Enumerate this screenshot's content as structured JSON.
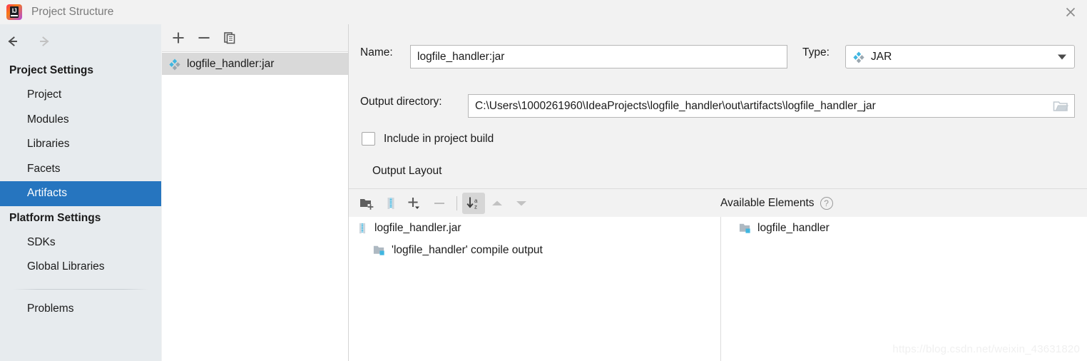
{
  "window": {
    "title": "Project Structure",
    "logo_icon": "intellij-idea-logo",
    "close_icon": "close-icon"
  },
  "nav": {
    "back_icon": "arrow-left-icon",
    "forward_icon": "arrow-right-icon"
  },
  "sidebar": {
    "groups": [
      {
        "title": "Project Settings",
        "items": [
          {
            "label": "Project",
            "selected": false
          },
          {
            "label": "Modules",
            "selected": false
          },
          {
            "label": "Libraries",
            "selected": false
          },
          {
            "label": "Facets",
            "selected": false
          },
          {
            "label": "Artifacts",
            "selected": true
          }
        ]
      },
      {
        "title": "Platform Settings",
        "items": [
          {
            "label": "SDKs",
            "selected": false
          },
          {
            "label": "Global Libraries",
            "selected": false
          }
        ]
      }
    ],
    "extra_items": [
      {
        "label": "Problems"
      }
    ]
  },
  "artifact_list": {
    "toolbar": [
      {
        "name": "add-artifact-button",
        "icon": "plus-icon"
      },
      {
        "name": "remove-artifact-button",
        "icon": "minus-icon"
      },
      {
        "name": "copy-artifact-button",
        "icon": "copy-icon"
      }
    ],
    "items": [
      {
        "label": "logfile_handler:jar",
        "icon": "artifact-jar-icon",
        "selected": true
      }
    ]
  },
  "details": {
    "name_label": "Name:",
    "name_value": "logfile_handler:jar",
    "type_label": "Type:",
    "type_value": "JAR",
    "type_icon": "artifact-jar-icon",
    "type_caret_icon": "chevron-down-icon",
    "output_dir_label": "Output directory:",
    "output_dir_value": "C:\\Users\\1000261960\\IdeaProjects\\logfile_handler\\out\\artifacts\\logfile_handler_jar",
    "browse_icon": "folder-open-icon",
    "include_in_build_label": "Include in project build",
    "include_in_build_checked": false,
    "output_layout_label": "Output Layout"
  },
  "layout_toolbar": {
    "buttons": [
      {
        "name": "create-directory-button",
        "icon": "folder-add-icon",
        "pressed": false,
        "disabled": false
      },
      {
        "name": "create-archive-button",
        "icon": "archive-icon",
        "pressed": false,
        "disabled": false
      },
      {
        "name": "add-copy-of-button",
        "icon": "plus-dropdown-icon",
        "pressed": false,
        "disabled": false
      },
      {
        "name": "remove-element-button",
        "icon": "minus-icon",
        "pressed": false,
        "disabled": true
      },
      {
        "name": "sort-by-name-button",
        "icon": "sort-az-icon",
        "pressed": true,
        "disabled": false
      },
      {
        "name": "move-up-button",
        "icon": "triangle-up-icon",
        "pressed": false,
        "disabled": true
      },
      {
        "name": "move-down-button",
        "icon": "triangle-down-icon",
        "pressed": false,
        "disabled": true
      }
    ]
  },
  "available_elements": {
    "title": "Available Elements",
    "help_icon": "question-mark-icon",
    "help_glyph": "?",
    "items": [
      {
        "label": "logfile_handler",
        "icon": "module-compile-output-icon",
        "indent": 1
      }
    ]
  },
  "output_layout_tree": {
    "nodes": [
      {
        "label": "logfile_handler.jar",
        "icon": "archive-icon",
        "indent": 0
      },
      {
        "label": "'logfile_handler' compile output",
        "icon": "module-compile-output-icon",
        "indent": 1
      }
    ]
  },
  "watermark": "https://blog.csdn.net/weixin_43631820",
  "colors": {
    "selection_blue": "#2675bf",
    "sidebar_bg": "#e7ebee",
    "panel_bg": "#f2f2f2",
    "list_selected_bg": "#d9d9d9",
    "icon_blue": "#40b6e0"
  }
}
